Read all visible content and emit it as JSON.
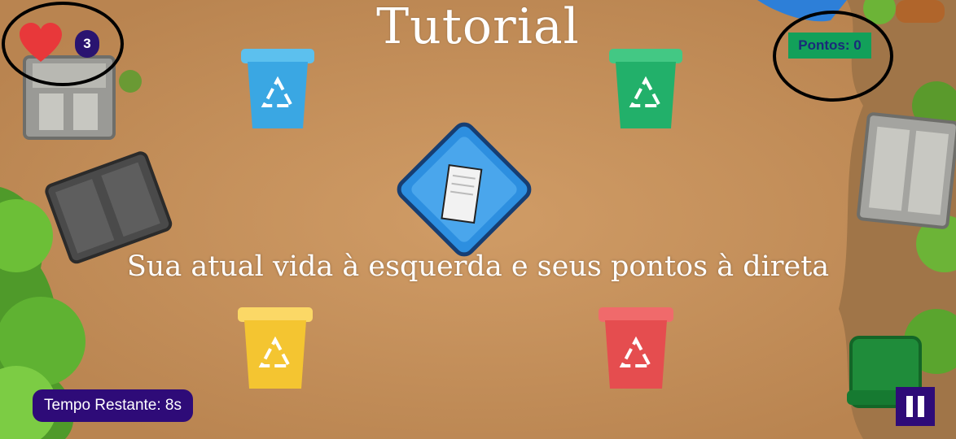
{
  "screen": {
    "title": "Tutorial",
    "hint": "Sua atual vida à esquerda e seus pontos à direta"
  },
  "hud": {
    "lives": "3",
    "points_label": "Pontos: 0",
    "timer_label": "Tempo Restante: 8s",
    "pause_icon": "pause-icon",
    "heart_icon": "heart-icon"
  },
  "bins": [
    {
      "color": "#3aa7e3",
      "lid": "#5cc0ee",
      "icon": "recycle-icon"
    },
    {
      "color": "#22b06a",
      "lid": "#43c884",
      "icon": "recycle-icon"
    },
    {
      "color": "#f4c531",
      "lid": "#fbd866",
      "icon": "recycle-icon"
    },
    {
      "color": "#e54d4f",
      "lid": "#f06a6b",
      "icon": "recycle-icon"
    }
  ],
  "falling_item": {
    "icon": "newspaper-icon",
    "tray_color": "#2d8fe0"
  },
  "colors": {
    "ground": "#c8945f",
    "accent": "#2e0b78",
    "points_bg": "#12a05a"
  }
}
